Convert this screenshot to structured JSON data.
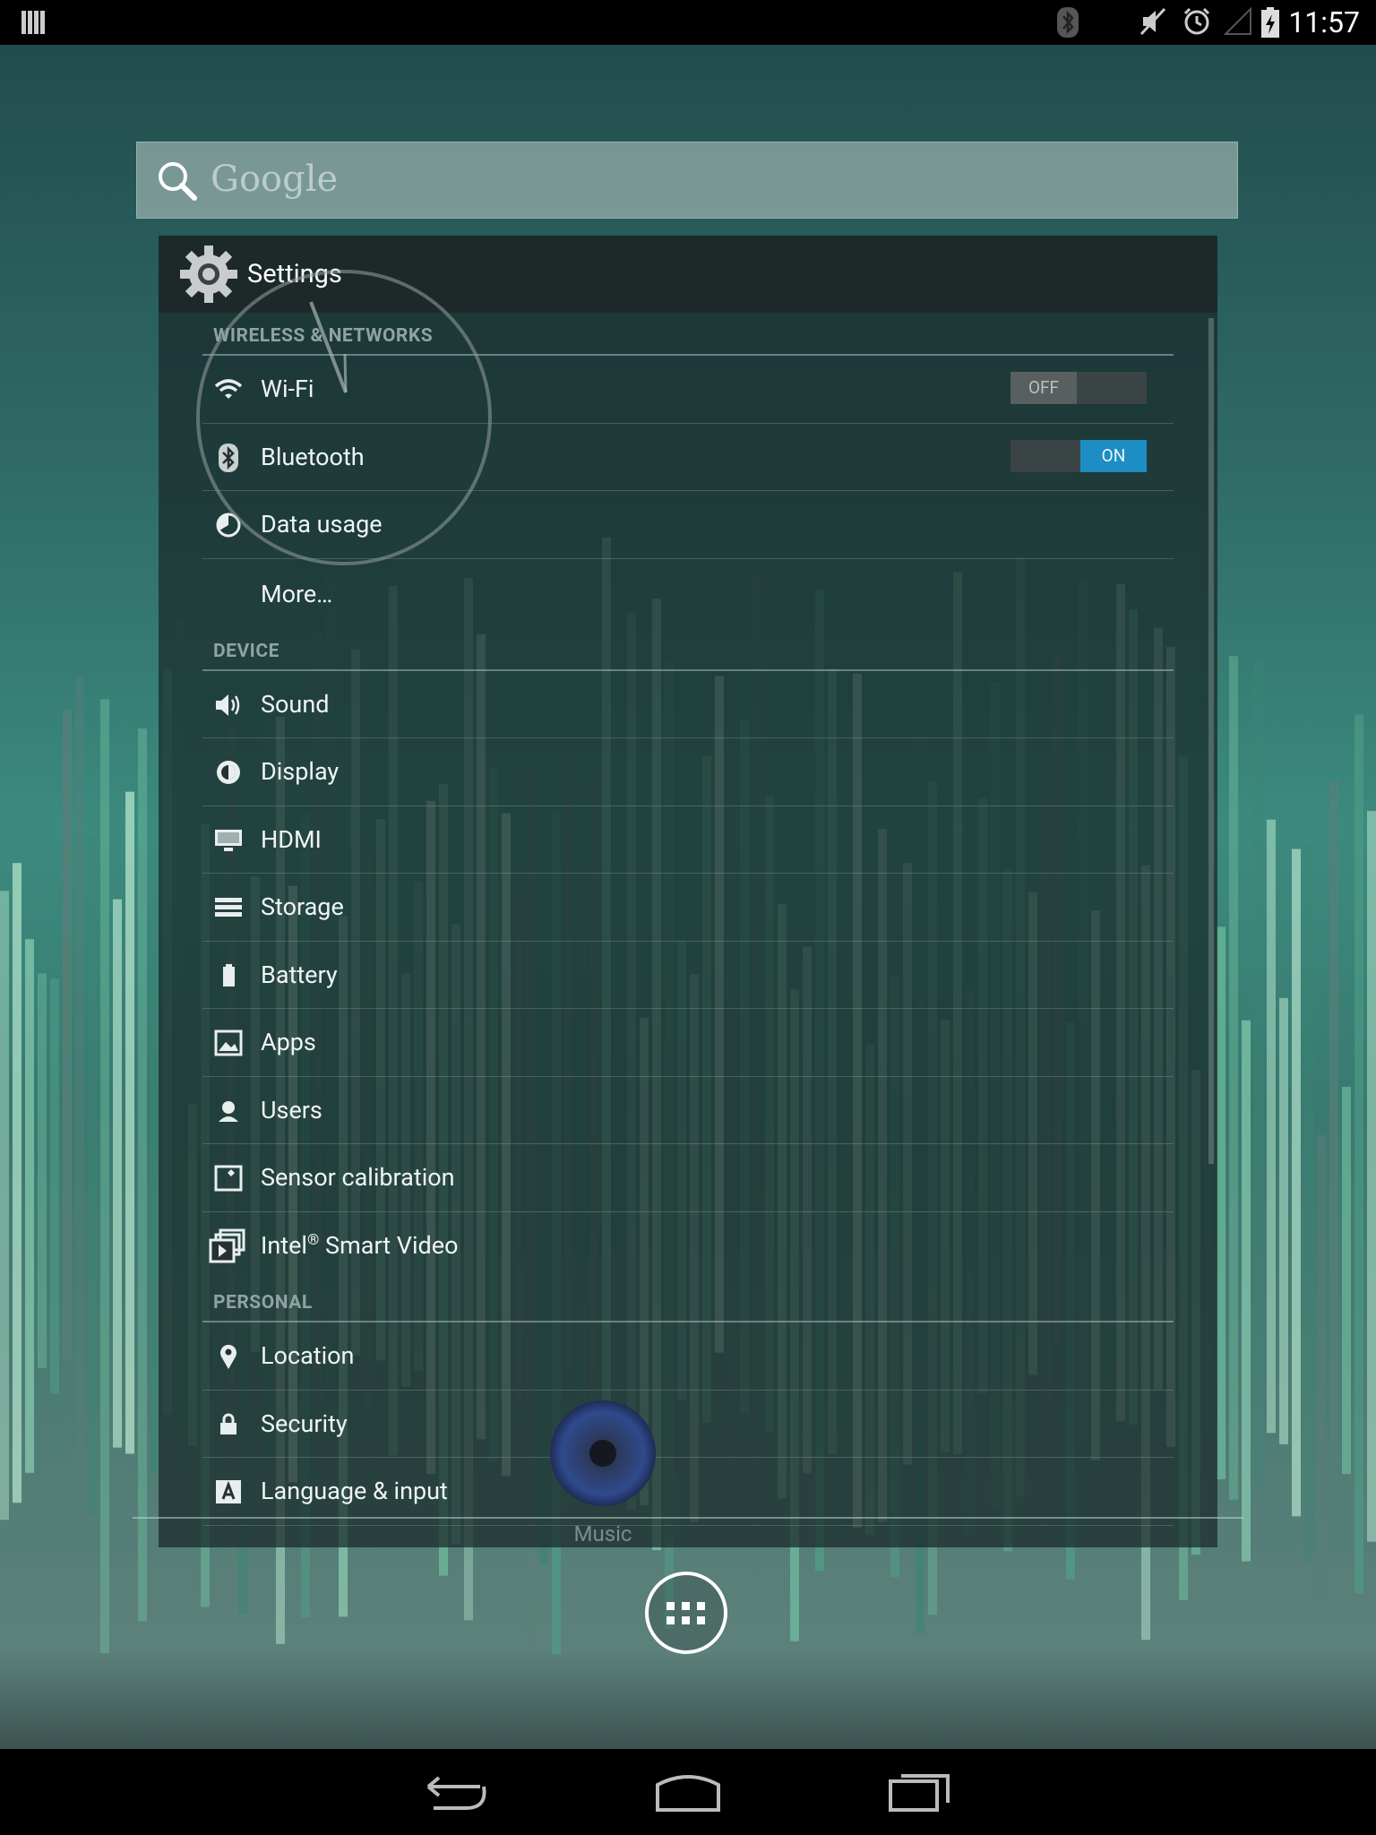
{
  "status_bar": {
    "time": "11:57",
    "icons": [
      "notification-bars-icon",
      "bluetooth-icon",
      "mute-icon",
      "alarm-icon",
      "signal-icon",
      "battery-charging-icon"
    ]
  },
  "search": {
    "label": "Google"
  },
  "settings_window": {
    "title": "Settings",
    "sections": [
      {
        "header": "WIRELESS & NETWORKS",
        "items": [
          {
            "label": "Wi-Fi",
            "icon": "wifi-icon",
            "toggle": "OFF"
          },
          {
            "label": "Bluetooth",
            "icon": "bluetooth-icon",
            "toggle": "ON"
          },
          {
            "label": "Data usage",
            "icon": "data-usage-icon"
          },
          {
            "label": "More…"
          }
        ]
      },
      {
        "header": "DEVICE",
        "items": [
          {
            "label": "Sound",
            "icon": "speaker-icon"
          },
          {
            "label": "Display",
            "icon": "brightness-icon"
          },
          {
            "label": "HDMI",
            "icon": "monitor-icon"
          },
          {
            "label": "Storage",
            "icon": "storage-icon"
          },
          {
            "label": "Battery",
            "icon": "battery-icon"
          },
          {
            "label": "Apps",
            "icon": "apps-image-icon"
          },
          {
            "label": "Users",
            "icon": "user-icon"
          },
          {
            "label": "Sensor calibration",
            "icon": "sensor-icon"
          },
          {
            "label_main": "Intel",
            "label_sup": "®",
            "label_rest": " Smart Video",
            "icon": "smart-video-icon"
          }
        ]
      },
      {
        "header": "PERSONAL",
        "items": [
          {
            "label": "Location",
            "icon": "location-pin-icon"
          },
          {
            "label": "Security",
            "icon": "lock-icon"
          },
          {
            "label": "Language & input",
            "icon": "keyboard-a-icon"
          }
        ]
      }
    ]
  },
  "dock": {
    "music_label": "Music"
  },
  "nav_bar": {
    "buttons": [
      "back-icon",
      "home-icon",
      "recents-icon"
    ]
  }
}
